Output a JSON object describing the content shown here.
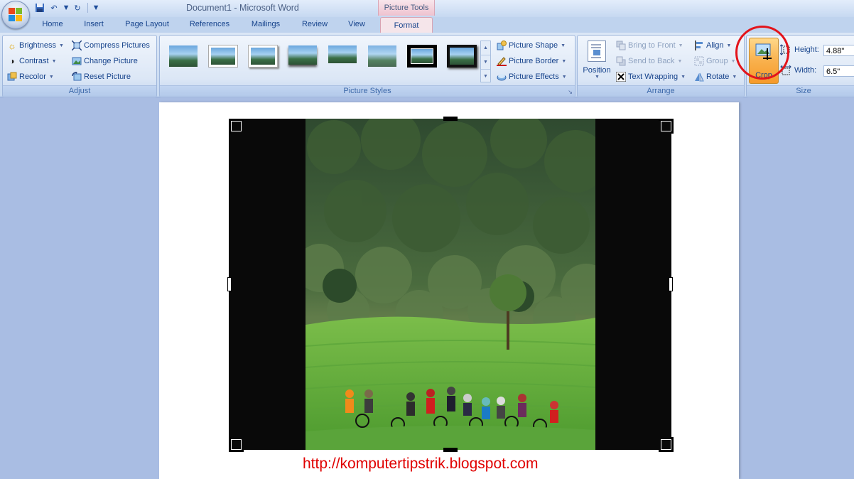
{
  "window": {
    "title": "Document1 - Microsoft Word",
    "context_tab_header": "Picture Tools"
  },
  "tabs": [
    {
      "label": "Home"
    },
    {
      "label": "Insert"
    },
    {
      "label": "Page Layout"
    },
    {
      "label": "References"
    },
    {
      "label": "Mailings"
    },
    {
      "label": "Review"
    },
    {
      "label": "View"
    },
    {
      "label": "Format",
      "active": true
    }
  ],
  "ribbon": {
    "adjust": {
      "label": "Adjust",
      "brightness": "Brightness",
      "contrast": "Contrast",
      "recolor": "Recolor",
      "compress": "Compress Pictures",
      "change": "Change Picture",
      "reset": "Reset Picture"
    },
    "picture_styles": {
      "label": "Picture Styles",
      "shape": "Picture Shape",
      "border": "Picture Border",
      "effects": "Picture Effects"
    },
    "arrange": {
      "label": "Arrange",
      "position": "Position",
      "bring_to_front": "Bring to Front",
      "send_to_back": "Send to Back",
      "text_wrapping": "Text Wrapping",
      "align": "Align",
      "group": "Group",
      "rotate": "Rotate"
    },
    "size": {
      "label": "Size",
      "crop": "Crop",
      "height_label": "Height:",
      "height_value": "4.88\"",
      "width_label": "Width:",
      "width_value": "6.5\""
    }
  },
  "document": {
    "caption": "http://komputertipstrik.blogspot.com"
  },
  "colors": {
    "accent_circle": "#e3141b",
    "caption": "#e00000",
    "crop_highlight": "#f9b14d"
  }
}
